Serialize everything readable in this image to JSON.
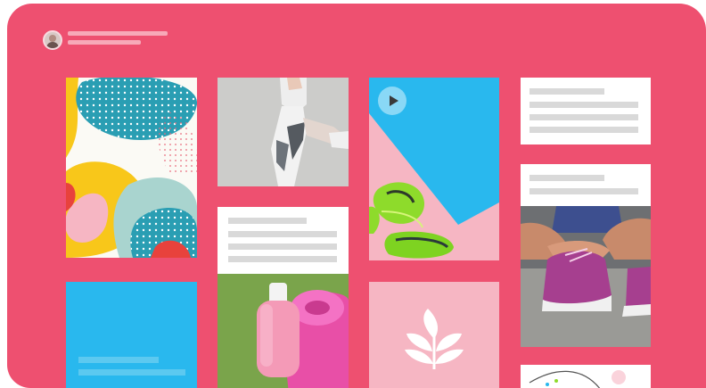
{
  "header": {
    "avatar_icon": "user-avatar",
    "line_count": 2
  },
  "colors": {
    "background": "#ee5070",
    "card_white": "#ffffff",
    "placeholder_line": "#d9d9d9",
    "sky_blue": "#29b8ee",
    "pale_pink": "#f6b6c3",
    "teal": "#2a9eb3",
    "yellow": "#f8c71a"
  },
  "feed": {
    "columns": [
      {
        "cards": [
          "abstract-pattern-image",
          "blue-placeholder-card"
        ]
      },
      {
        "cards": [
          "workout-legs-image",
          "text-placeholder-card",
          "water-bottle-yoga-mat-image"
        ]
      },
      {
        "cards": [
          "sneakers-video-card",
          "leaf-logo-card"
        ]
      },
      {
        "cards": [
          "text-placeholder-card",
          "text-placeholder-card",
          "tying-shoes-image",
          "sketch-card"
        ]
      }
    ],
    "video_icon": "play-icon",
    "logo_icon": "leaf-icon"
  }
}
